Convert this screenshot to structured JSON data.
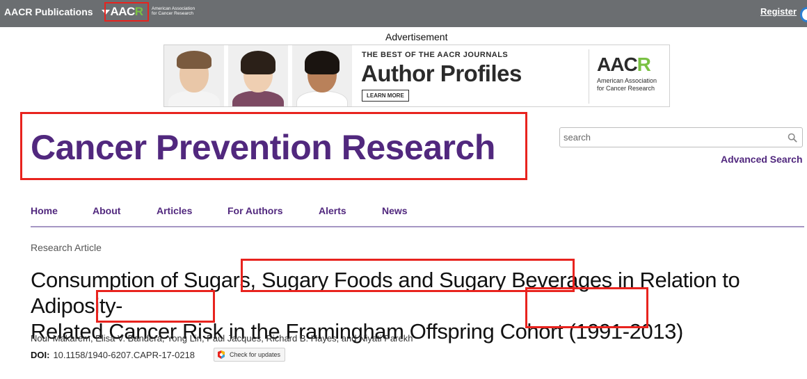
{
  "topbar": {
    "publications_label": "AACR Publications",
    "logo_text_a": "AAC",
    "logo_text_r": "R",
    "org_line1": "American Association",
    "org_line2": "for Cancer Research",
    "register_label": "Register",
    "right_stub_letter": "L"
  },
  "advertisement": {
    "label": "Advertisement",
    "kicker": "THE BEST OF THE AACR JOURNALS",
    "headline": "Author Profiles",
    "cta": "LEARN MORE",
    "logo_text_a": "AAC",
    "logo_text_r": "R",
    "org_line1": "American Association",
    "org_line2": "for Cancer Research"
  },
  "journal": {
    "title": "Cancer Prevention Research"
  },
  "search": {
    "placeholder": "search",
    "value": "",
    "advanced_label": "Advanced Search"
  },
  "nav": {
    "items": [
      {
        "label": "Home"
      },
      {
        "label": "About"
      },
      {
        "label": "Articles"
      },
      {
        "label": "For Authors"
      },
      {
        "label": "Alerts"
      },
      {
        "label": "News"
      }
    ]
  },
  "article": {
    "type": "Research Article",
    "title_line1_a": "Consumption of Sugars, ",
    "title_line1_b": "Sugary Foods and Sugary Beverages",
    "title_line1_c": " in Relation to Adiposity-",
    "title_line2_a": "Related ",
    "title_line2_b": "Cancer Risk",
    "title_line2_c": " in the Framingham Offspring Cohort ",
    "title_line2_d": "(1991-2013)",
    "authors": "Nour Makarem, Elisa V. Bandera, Yong Lin, Paul Jacques, Richard B. Hayes, and Niyati Parekh",
    "doi_label": "DOI:",
    "doi_value": "10.1158/1940-6207.CAPR-17-0218",
    "check_updates_label": "Check for updates"
  },
  "colors": {
    "brand_purple": "#51287e",
    "highlight_red": "#e8231e",
    "topbar_gray": "#6b6e71",
    "aacr_green": "#7ac143"
  }
}
